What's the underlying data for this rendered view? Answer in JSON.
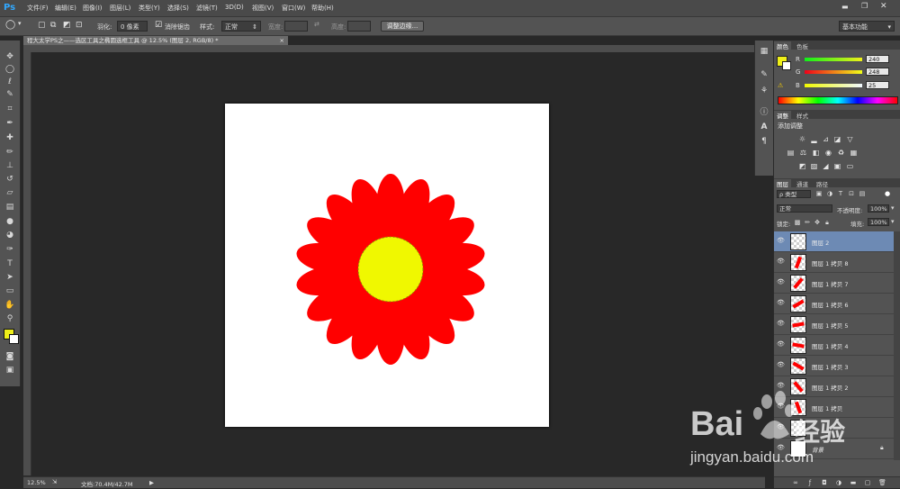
{
  "app": {
    "logo": "Ps",
    "workspace": "基本功能"
  },
  "menu": [
    "文件(F)",
    "编辑(E)",
    "图像(I)",
    "图层(L)",
    "类型(Y)",
    "选择(S)",
    "滤镜(T)",
    "3D(D)",
    "视图(V)",
    "窗口(W)",
    "帮助(H)"
  ],
  "options": {
    "feather_label": "羽化:",
    "feather_value": "0 像素",
    "antialias_label": "消除锯齿",
    "style_label": "样式:",
    "style_value": "正常",
    "width_label": "宽度:",
    "height_label": "高度:",
    "refine_edge": "调整边缘..."
  },
  "document": {
    "tab_title": "程大太学PS之——选区工具之椭圆选框工具 @ 12.5% (图层 2, RGB/8) *",
    "zoom": "12.5%",
    "doc_info": "文档:70.4M/42.7M"
  },
  "ruler": {
    "top": [
      "25",
      "20",
      "15",
      "10",
      "5",
      "0",
      "5",
      "10",
      "15",
      "20",
      "25",
      "30",
      "35",
      "40",
      "45",
      "50",
      "55",
      "60",
      "65"
    ],
    "left": [
      "1",
      "0",
      "5",
      "1",
      "0",
      "2",
      "0",
      "2",
      "5",
      "3",
      "0",
      "3",
      "5"
    ]
  },
  "colors": {
    "foreground": "#f0f019",
    "background": "#ffffff",
    "petal": "#ff0000",
    "center": "#f0f800",
    "selected_layer": "#6d8ab4"
  },
  "color_panel": {
    "tabs": [
      "颜色",
      "色板"
    ],
    "r_label": "R",
    "r_value": "240",
    "g_label": "G",
    "g_value": "248",
    "b_label": "B",
    "b_value": "25"
  },
  "adjust_panel": {
    "tabs": [
      "调整",
      "样式"
    ],
    "title": "添加调整"
  },
  "layers_panel": {
    "tabs": [
      "图层",
      "通道",
      "路径"
    ],
    "filter_label": "ρ 类型",
    "blend_mode": "正常",
    "opacity_label": "不透明度:",
    "opacity_value": "100%",
    "lock_label": "锁定:",
    "fill_label": "填充:",
    "fill_value": "100%",
    "layers": [
      {
        "name": "图层 2",
        "selected": true
      },
      {
        "name": "图层 1 拷贝 8",
        "selected": false
      },
      {
        "name": "图层 1 拷贝 7",
        "selected": false
      },
      {
        "name": "图层 1 拷贝 6",
        "selected": false
      },
      {
        "name": "图层 1 拷贝 5",
        "selected": false
      },
      {
        "name": "图层 1 拷贝 4",
        "selected": false
      },
      {
        "name": "图层 1 拷贝 3",
        "selected": false
      },
      {
        "name": "图层 1 拷贝 2",
        "selected": false
      },
      {
        "name": "图层 1 拷贝",
        "selected": false
      },
      {
        "name": "",
        "selected": false
      },
      {
        "name": "背景",
        "selected": false
      }
    ]
  },
  "watermark": {
    "brand": "Bai",
    "brand2": "经验",
    "url": "jingyan.baidu.com"
  }
}
